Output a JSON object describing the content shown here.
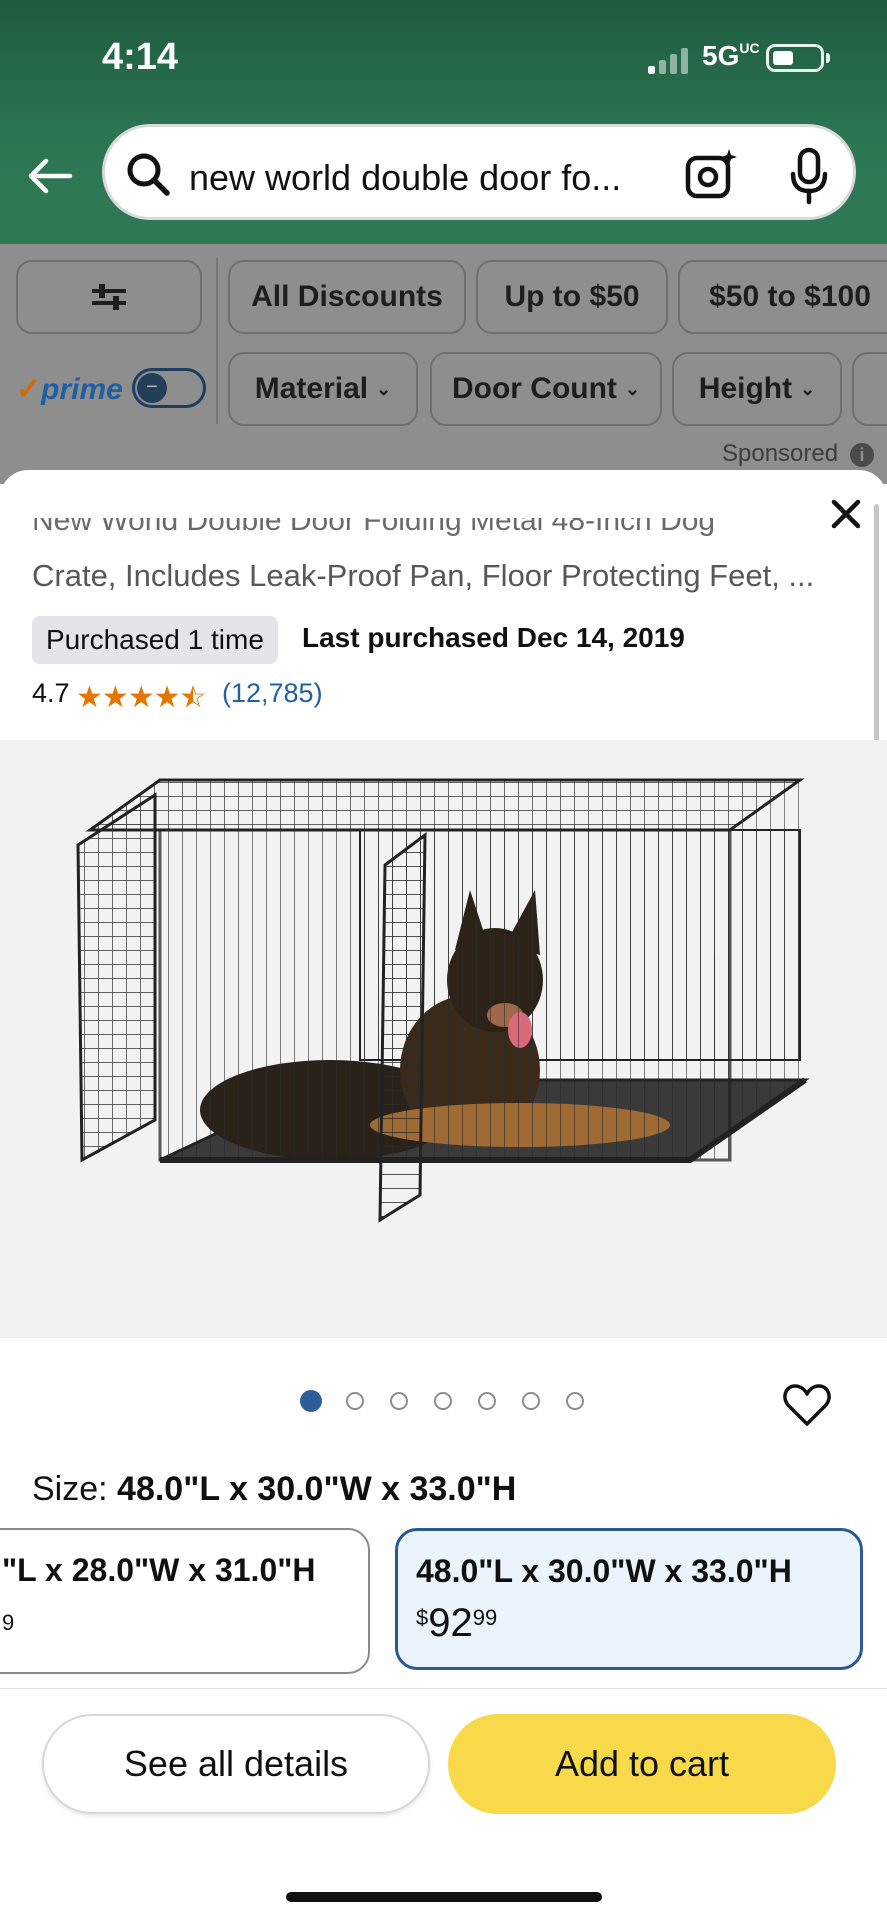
{
  "status_bar": {
    "time": "4:14",
    "network": "5G",
    "network_sup": "UC"
  },
  "search": {
    "query": "new world double door fo...",
    "icons": [
      "back-arrow-icon",
      "search-icon",
      "camera-sparkle-icon",
      "microphone-icon"
    ]
  },
  "filters": {
    "row1": [
      "All Discounts",
      "Up to $50",
      "$50 to $100"
    ],
    "row2": [
      "Material",
      "Door Count",
      "Height"
    ],
    "prime_label": "prime",
    "sponsored": "Sponsored"
  },
  "product": {
    "title_cut": "New World Double Door Folding Metal 48-Inch Dog",
    "title": "Crate, Includes Leak-Proof Pan, Floor Protecting Feet, ...",
    "purchased_badge": "Purchased 1 time",
    "last_purchased": "Last purchased Dec 14, 2019",
    "rating": "4.7",
    "stars_filled": 4.5,
    "review_count": "(12,785)",
    "image_count": 7,
    "active_image": 1
  },
  "size": {
    "label": "Size:",
    "selected": "48.0\"L x 30.0\"W x 33.0\"H",
    "options": [
      {
        "label": "\"L x 28.0\"W x 31.0\"H",
        "price_main": "",
        "price_cents": "9",
        "selected": false
      },
      {
        "label": "48.0\"L x 30.0\"W x 33.0\"H",
        "price_symbol": "$",
        "price_main": "92",
        "price_cents": "99",
        "selected": true
      }
    ]
  },
  "actions": {
    "details": "See all details",
    "cart": "Add to cart"
  },
  "colors": {
    "header_green": "#2c7552",
    "cart_yellow": "#f7d94a",
    "selected_border": "#2a5a94",
    "star_orange": "#e77600",
    "link_blue": "#2162a1"
  }
}
